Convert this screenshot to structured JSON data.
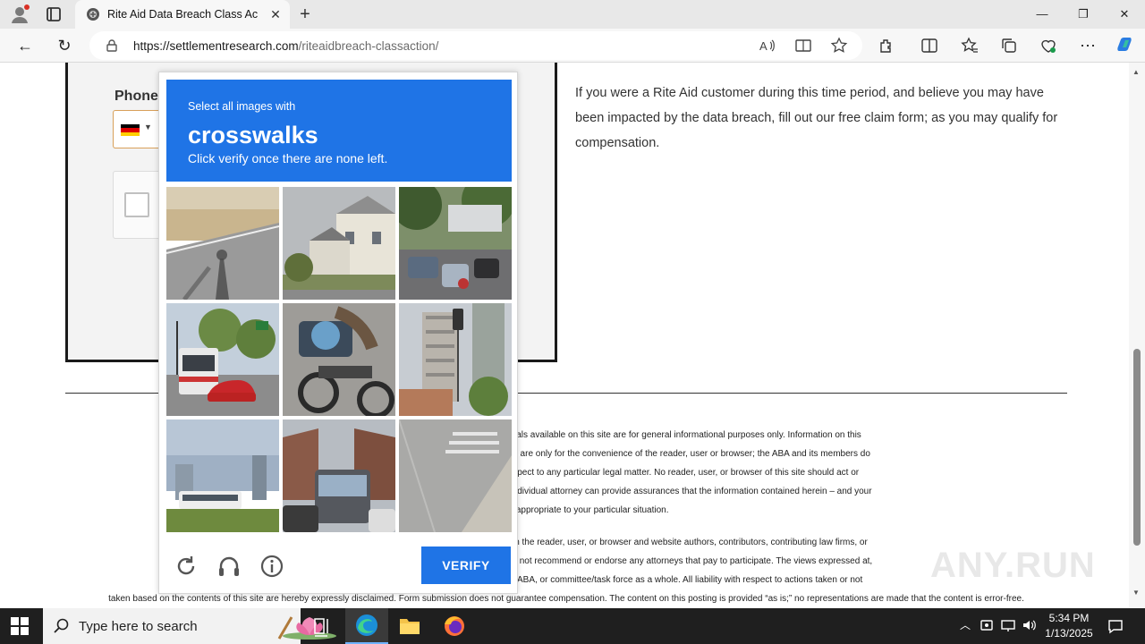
{
  "browser": {
    "tab_title": "Rite Aid Data Breach Class Action",
    "tab_close": "✕",
    "new_tab": "+",
    "url_host": "https://settlementresearch.com",
    "url_path": "/riteaidbreach-classaction/",
    "win_min": "—",
    "win_max": "❐",
    "win_close": "✕",
    "back": "←",
    "refresh": "↻",
    "more": "⋯"
  },
  "page": {
    "phone_label": "Phone",
    "right_text": "If you were a Rite Aid customer during this time period, and believe you may have been impacted by the data breach, fill out our free claim form; as you may qualify for compensation.",
    "disclaimer_1": [
      "The information pro… …d, all information, content, and materials available on this site are for general informational purposes only. Information on this",
      "website may not con… …o other third-party websites. Such links are only for the convenience of the reader, user or browser; the ABA and its members do",
      "not recommend or… …their attorney to obtain advice with respect to any particular legal matter. No reader, user, or browser of this site should act or",
      "refrain from acting on… …n the relevant jurisdiction. Only your individual attorney can provide assurances that the information contained herein – and your",
      "…plicable or appropriate to your particular situation."
    ],
    "disclaimer_2": [
      "Use of, and access to… …n attorney-client relationship between the reader, user, or browser and website authors, contributors, contributing law firms, or",
      "committee members… …not directly provide legal advice. We do not recommend or endorse any attorneys that pay to participate. The views expressed at,",
      "or through, this site… …ose of their respective employers, the ABA, or committee/task force as a whole. All liability with respect to actions taken or not",
      "taken based on the contents of this site are hereby expressly disclaimed. Form submission does not guarantee compensation. The content on this posting is provided “as is;” no representations are made that the content is error-free."
    ],
    "watermark": "ANY.RUN"
  },
  "captcha": {
    "prompt_pre": "Select all images with",
    "target": "crosswalks",
    "prompt_sub": "Click verify once there are none left.",
    "verify_label": "VERIFY",
    "tiles": [
      "road-shadow",
      "houses-street",
      "traffic-scooters",
      "bus-car-intersection",
      "motorbike-closeup",
      "tower-traffic-light",
      "bus-field",
      "bus-street",
      "crosswalk-road"
    ]
  },
  "taskbar": {
    "search_placeholder": "Type here to search",
    "time": "5:34 PM",
    "date": "1/13/2025"
  },
  "colors": {
    "captcha_blue": "#1f74e6",
    "taskbar": "#1f1f1f"
  }
}
